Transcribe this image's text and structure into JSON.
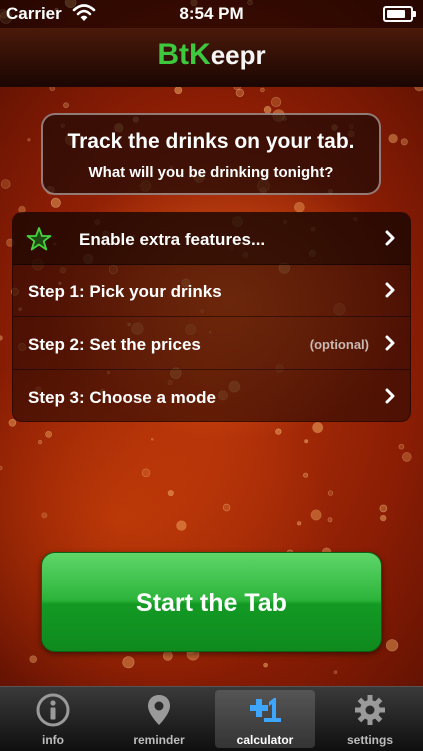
{
  "status_bar": {
    "carrier": "Carrier",
    "time": "8:54 PM"
  },
  "nav": {
    "logo_accent": "BtK",
    "logo_rest": "eepr"
  },
  "intro": {
    "title": "Track the drinks on your tab.",
    "subtitle": "What will you be drinking tonight?"
  },
  "menu": {
    "items": [
      {
        "label": "Enable extra features...",
        "icon": "star-icon"
      },
      {
        "label": "Step 1: Pick your drinks"
      },
      {
        "label": "Step 2: Set the prices",
        "note": "(optional)"
      },
      {
        "label": "Step 3: Choose a mode"
      }
    ]
  },
  "start_button": {
    "label": "Start the Tab"
  },
  "tab_bar": {
    "tabs": [
      {
        "label": "info",
        "icon": "info-icon"
      },
      {
        "label": "reminder",
        "icon": "map-pin-icon"
      },
      {
        "label": "calculator",
        "icon": "calculator-plus-one-icon",
        "selected": true
      },
      {
        "label": "settings",
        "icon": "gear-icon"
      }
    ]
  },
  "colors": {
    "accent_green": "#2cb43a",
    "logo_green": "#3ec83e"
  }
}
